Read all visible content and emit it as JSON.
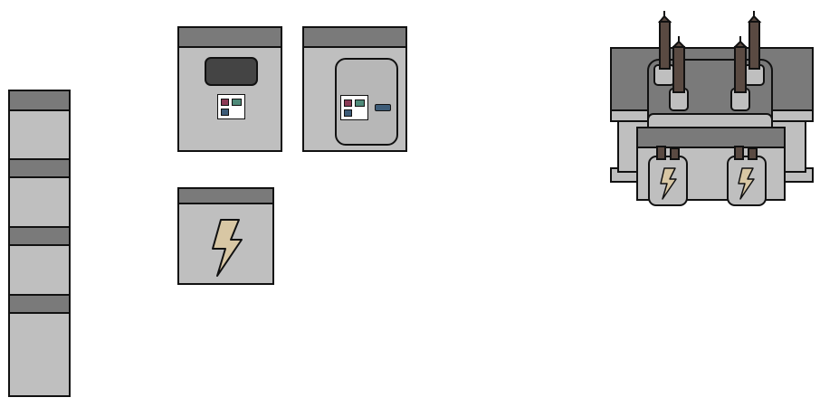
{
  "colors": {
    "panel_body": "#bfbfbf",
    "panel_cap": "#7a7a7a",
    "outline": "#111111",
    "display": "#444444",
    "rod": "#5a4a42",
    "bolt_icon": "#d8c7a4",
    "led_red": "#8b3a55",
    "led_teal": "#4f8a79",
    "led_blue": "#3d5c78"
  },
  "objects": [
    {
      "id": "cabinet-stack",
      "icon": "stacked-cabinet-icon",
      "modules": 4
    },
    {
      "id": "control-panel-display",
      "icon": "control-panel-icon"
    },
    {
      "id": "control-panel-door",
      "icon": "control-panel-door-icon"
    },
    {
      "id": "power-box",
      "icon": "lightning-icon"
    },
    {
      "id": "transformer",
      "icon": "transformer-icon",
      "bushings": 4,
      "power_units": 2
    }
  ]
}
